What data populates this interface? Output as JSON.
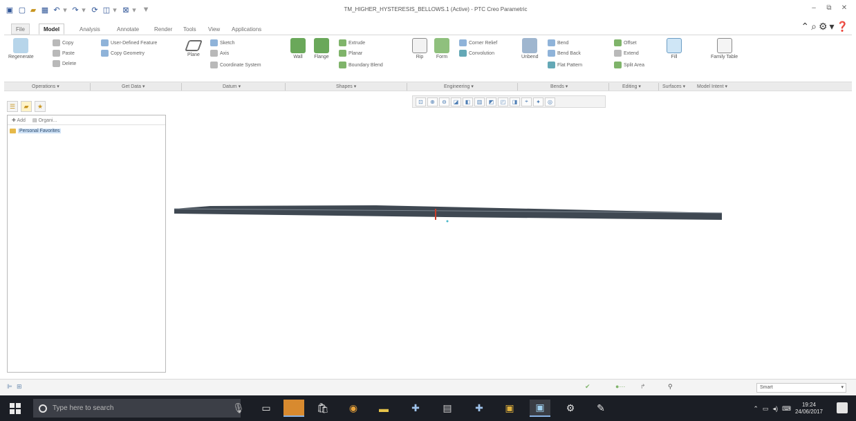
{
  "window": {
    "title": "TM_HIGHER_HYSTERESIS_BELLOWS.1 (Active) - PTC Creo Parametric"
  },
  "ribbon_tabs": [
    {
      "label": "File"
    },
    {
      "label": "Model"
    },
    {
      "label": "Analysis"
    },
    {
      "label": "Annotate"
    },
    {
      "label": "Render"
    },
    {
      "label": "Tools"
    },
    {
      "label": "View"
    },
    {
      "label": "Applications"
    }
  ],
  "ribbon": {
    "regenerate": "Regenerate",
    "copy": "Copy",
    "paste": "Paste",
    "delete": "Delete",
    "user_defined_feature": "User-Defined Feature",
    "copy_geometry": "Copy Geometry",
    "plane": "Plane",
    "sketch": "Sketch",
    "axis": "Axis",
    "coordinate_system": "Coordinate System",
    "wall": "Wall",
    "flange": "Flange",
    "extrude": "Extrude",
    "planar": "Planar",
    "boundary_blend": "Boundary Blend",
    "rip": "Rip",
    "form": "Form",
    "corner_relief": "Corner Relief",
    "convolution": "Convolution",
    "unbend": "Unbend",
    "bend": "Bend",
    "bend_back": "Bend Back",
    "flat_pattern": "Flat Pattern",
    "offset": "Offset",
    "extend": "Extend",
    "split_area": "Split Area",
    "fill": "Fill",
    "family_table": "Family Table"
  },
  "ribbon_groups": [
    "Operations",
    "Get Data",
    "Datum",
    "Shapes",
    "Engineering",
    "Bends",
    "Editing",
    "Surfaces",
    "Model Intent"
  ],
  "model_tree": {
    "toolbar_left": "Add",
    "toolbar_right": "Organi...",
    "folder_label": "Personal Favorites"
  },
  "statusbar": {
    "selection_filter": "Smart"
  },
  "taskbar": {
    "search_placeholder": "Type here to search",
    "time": "19:24",
    "date": "24/06/2017"
  },
  "colors": {
    "model_part": "#3f4852",
    "datum_marker": "#c83c2a",
    "csys_marker": "#49b8c9",
    "taskbar": "#1b1e25"
  }
}
